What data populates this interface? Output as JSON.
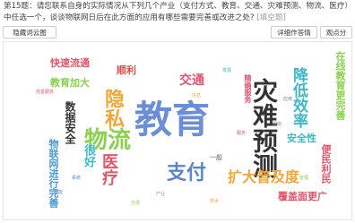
{
  "question": {
    "text": "第15题：请您联系自身的实际情况从下列几个产业（支付方式、教育、交通、灾难预测、物流、医疗）中任选一个，谈谈物联网日后在此方面的应用有哪些需要完善或改进之处?",
    "tag": "[填空题]"
  },
  "buttons": {
    "hide_cloud": "隐藏词云图",
    "detail": "详细作答情况",
    "view_points": "观点分析"
  },
  "word_cloud": {
    "words": [
      {
        "text": "教育",
        "color": "#6b8fd6"
      },
      {
        "text": "灾难预测",
        "color": "#333333"
      },
      {
        "text": "物流",
        "color": "#8bd04e"
      },
      {
        "text": "隐私",
        "color": "#f0a73a"
      },
      {
        "text": "医疗",
        "color": "#e0566b"
      },
      {
        "text": "支付",
        "color": "#5b86c9"
      },
      {
        "text": "降低效率",
        "color": "#3fb9c8"
      },
      {
        "text": "扩大普及度",
        "color": "#f0a73a"
      },
      {
        "text": "交通",
        "color": "#e0566b"
      },
      {
        "text": "快速流通",
        "color": "#e0566b"
      },
      {
        "text": "顺利",
        "color": "#d9534f"
      },
      {
        "text": "教育加大",
        "color": "#8bd04e"
      },
      {
        "text": "数据安全",
        "color": "#333333"
      },
      {
        "text": "很好",
        "color": "#3fb9c8"
      },
      {
        "text": "物联网进行完善",
        "color": "#4a9ad6"
      },
      {
        "text": "覆盖面更广",
        "color": "#e0566b"
      },
      {
        "text": "安全性",
        "color": "#3fb9c8"
      },
      {
        "text": "便民利民",
        "color": "#e0566b"
      },
      {
        "text": "在线教育更完善",
        "color": "#8bd04e"
      },
      {
        "text": "精确服务",
        "color": "#e0566b"
      },
      {
        "text": "一般",
        "color": "#999999"
      }
    ],
    "tiny_words": [
      {
        "text": "完善服务",
        "color": "#e0566b"
      },
      {
        "text": "智能",
        "color": "#5b86c9"
      },
      {
        "text": "方便",
        "color": "#8bd04e"
      },
      {
        "text": "产业",
        "color": "#999999"
      },
      {
        "text": "技术",
        "color": "#f0a73a"
      },
      {
        "text": "发展",
        "color": "#3fb9c8"
      },
      {
        "text": "应用",
        "color": "#5b86c9"
      },
      {
        "text": "网络",
        "color": "#999999"
      },
      {
        "text": "服务",
        "color": "#e0566b"
      },
      {
        "text": "管理",
        "color": "#8bd04e"
      },
      {
        "text": "系统",
        "color": "#5b86c9"
      },
      {
        "text": "信息",
        "color": "#f0a73a"
      }
    ]
  }
}
